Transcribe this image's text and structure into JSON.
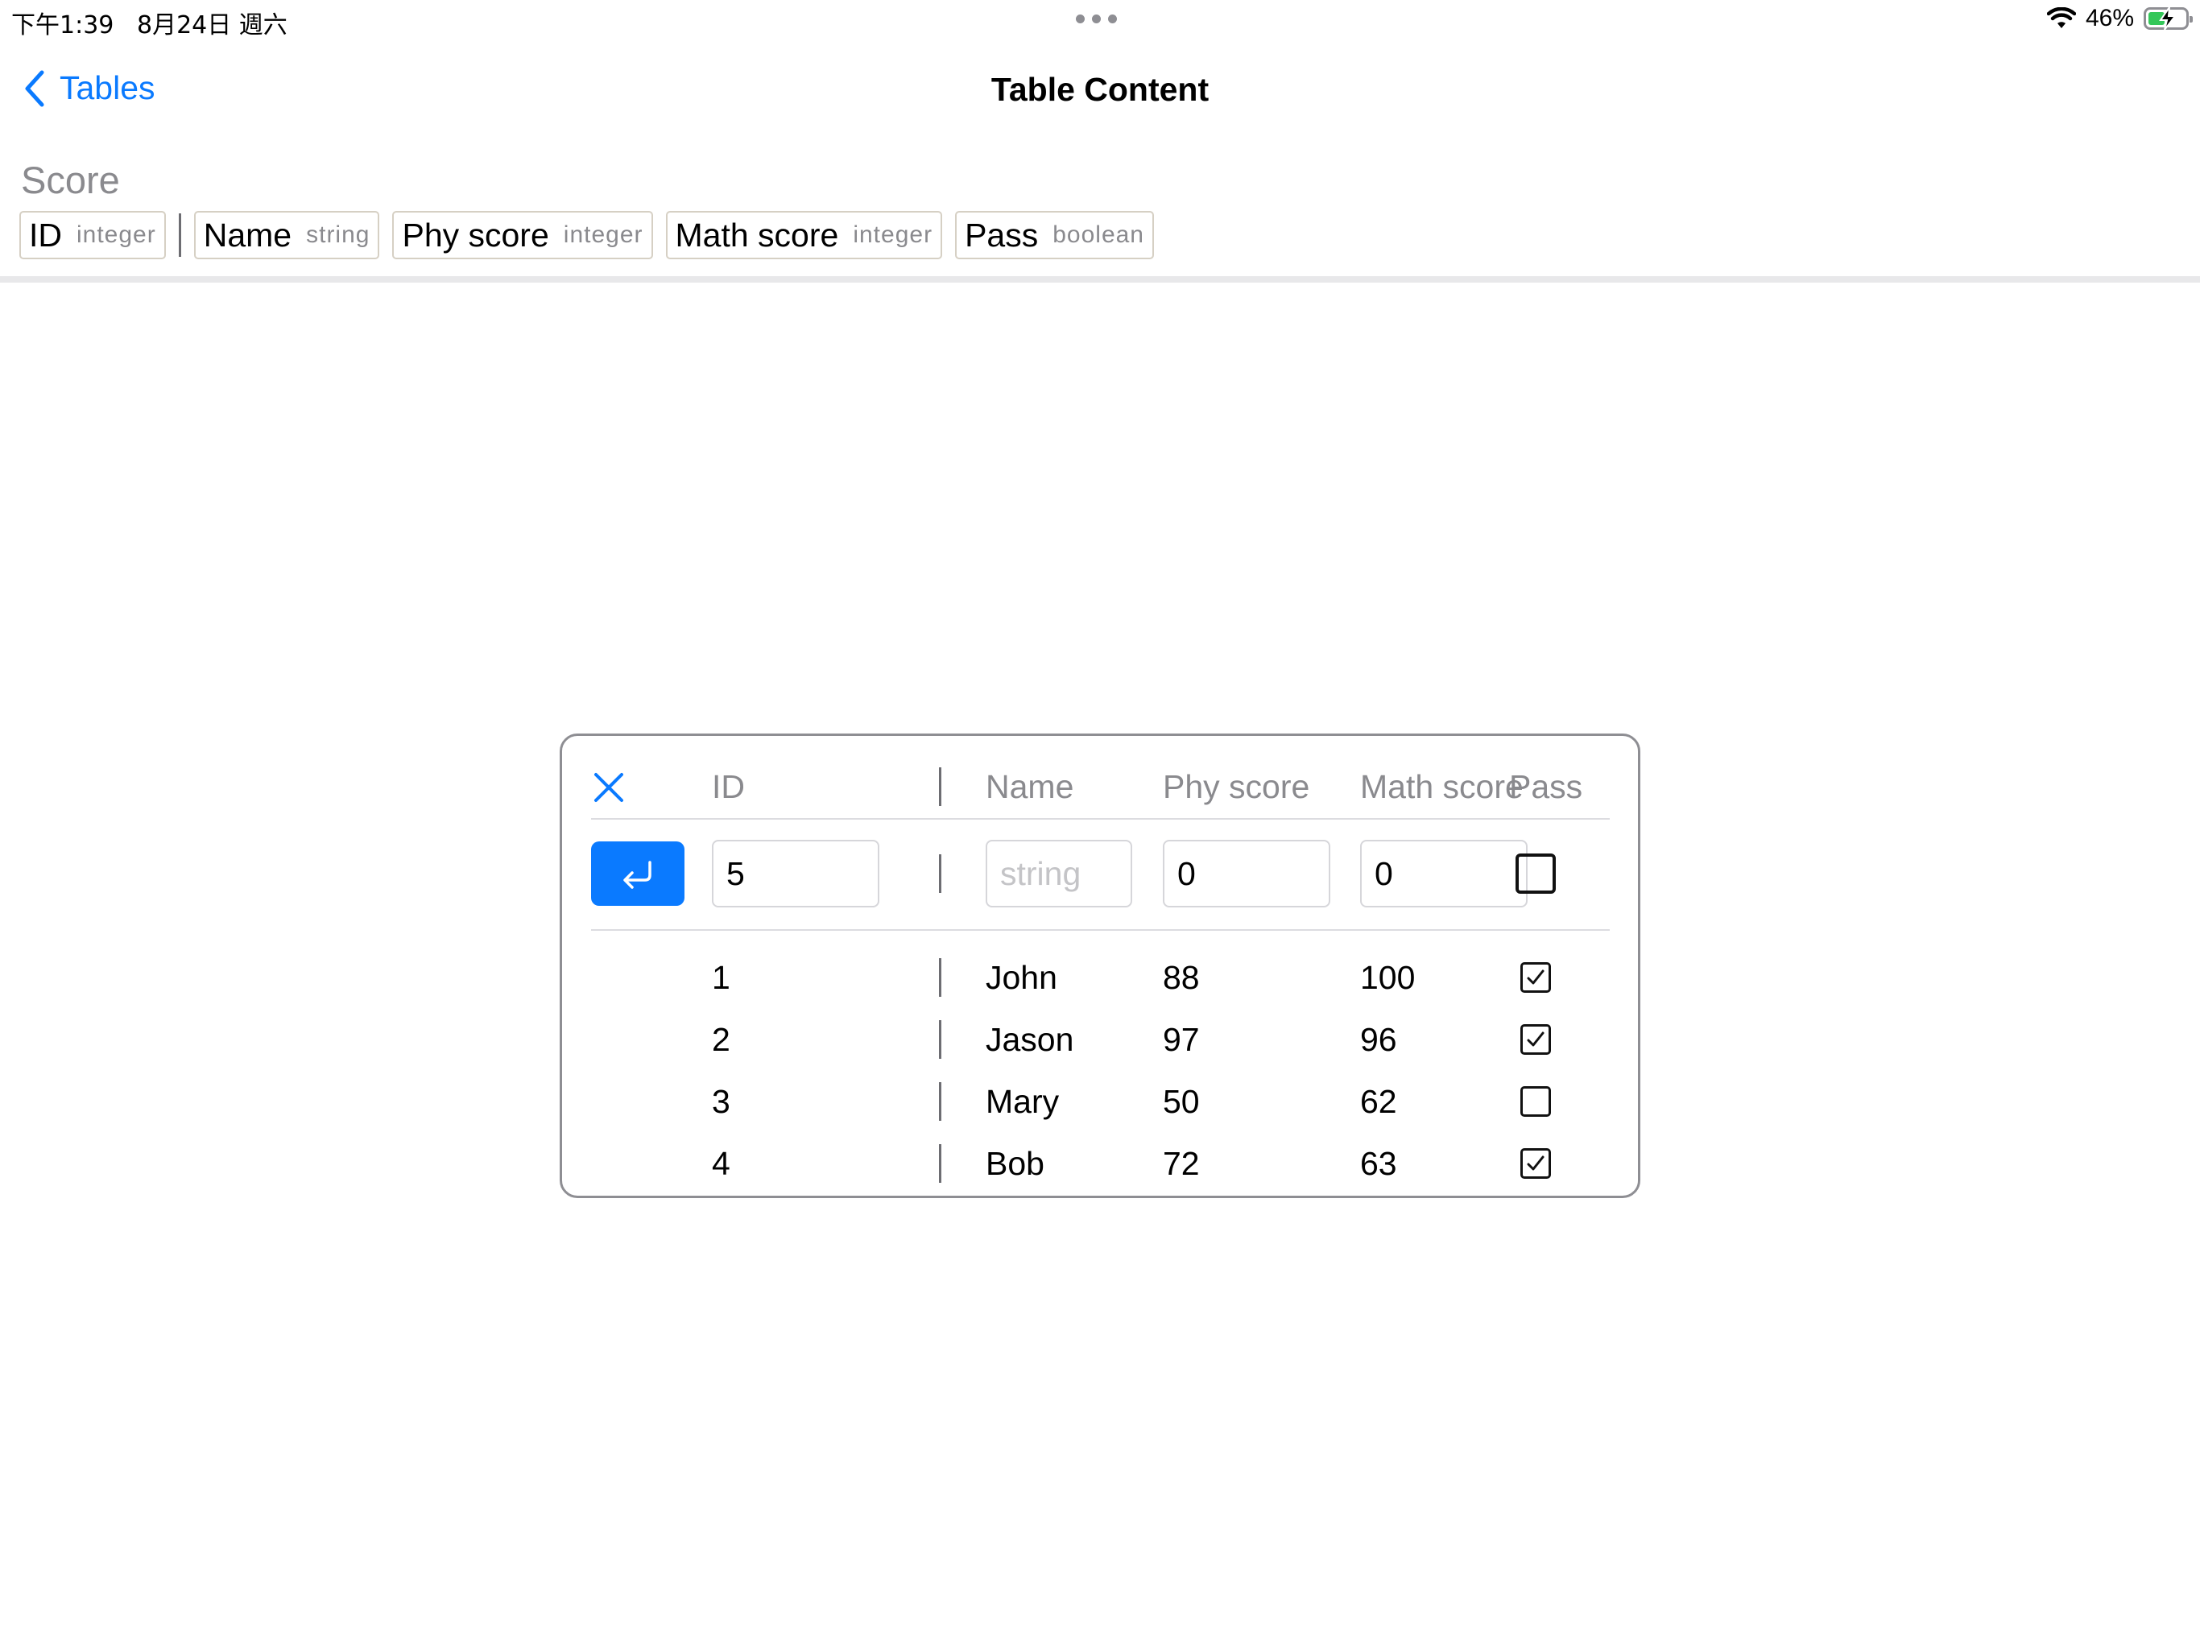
{
  "status_bar": {
    "time": "下午1:39",
    "date": "8月24日 週六",
    "battery": "46%"
  },
  "nav": {
    "back_label": "Tables",
    "title": "Table Content"
  },
  "table": {
    "name": "Score",
    "columns": [
      {
        "name": "ID",
        "type": "integer"
      },
      {
        "name": "Name",
        "type": "string"
      },
      {
        "name": "Phy score",
        "type": "integer"
      },
      {
        "name": "Math score",
        "type": "integer"
      },
      {
        "name": "Pass",
        "type": "boolean"
      }
    ]
  },
  "dialog": {
    "headers": [
      "ID",
      "Name",
      "Phy score",
      "Math score",
      "Pass"
    ],
    "new_row": {
      "id": "5",
      "name": "",
      "name_placeholder": "string",
      "phy": "0",
      "math": "0",
      "pass": false
    },
    "rows": [
      {
        "id": "1",
        "name": "John",
        "phy": "88",
        "math": "100",
        "pass": true
      },
      {
        "id": "2",
        "name": "Jason",
        "phy": "97",
        "math": "96",
        "pass": true
      },
      {
        "id": "3",
        "name": "Mary",
        "phy": "50",
        "math": "62",
        "pass": false
      },
      {
        "id": "4",
        "name": "Bob",
        "phy": "72",
        "math": "63",
        "pass": true
      }
    ]
  },
  "colors": {
    "accent": "#0a7aff",
    "secondary_text": "#8a8a8e",
    "chip_border": "#d6d0c4"
  }
}
